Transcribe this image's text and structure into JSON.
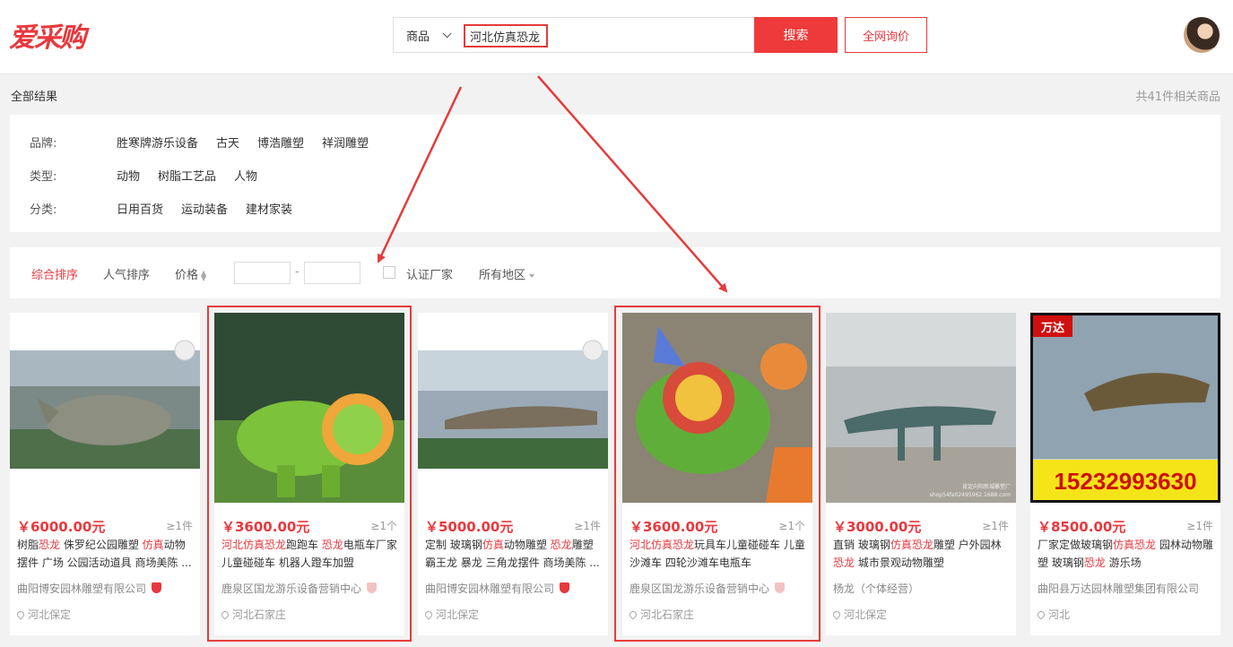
{
  "header": {
    "logo_text": "爱采购",
    "search_category": "商品",
    "search_query": "河北仿真恐龙",
    "search_button": "搜索",
    "inquiry_button": "全网询价"
  },
  "results": {
    "title": "全部结果",
    "count": "共41件相关商品"
  },
  "filters": {
    "brand": {
      "label": "品牌:",
      "options": [
        "胜寒牌游乐设备",
        "古天",
        "博浩雕塑",
        "祥润雕塑"
      ]
    },
    "type": {
      "label": "类型:",
      "options": [
        "动物",
        "树脂工艺品",
        "人物"
      ]
    },
    "category": {
      "label": "分类:",
      "options": [
        "日用百货",
        "运动装备",
        "建材家装"
      ]
    }
  },
  "sortbar": {
    "comprehensive": "综合排序",
    "popularity": "人气排序",
    "price": "价格",
    "price_dash": "-",
    "certified": "认证厂家",
    "region": "所有地区"
  },
  "products": [
    {
      "price": "￥6000.00元",
      "moq": "≥1件",
      "title_parts": [
        [
          "树脂",
          false
        ],
        [
          "恐龙",
          true
        ],
        [
          " 侏罗纪公园雕塑 ",
          false
        ],
        [
          "仿真",
          true
        ],
        [
          "动物摆件 广场 公园活动道具 商场美陈 ...",
          false
        ]
      ],
      "company": "曲阳博安园林雕塑有限公司",
      "badge": "red",
      "location": "河北保定"
    },
    {
      "price": "￥3600.00元",
      "moq": "≥1个",
      "title_parts": [
        [
          "河北仿真恐龙",
          true
        ],
        [
          "跑跑车 ",
          false
        ],
        [
          "恐龙",
          true
        ],
        [
          "电瓶车厂家 儿童碰碰车 机器人蹬车加盟",
          false
        ]
      ],
      "company": "鹿泉区国龙游乐设备营销中心",
      "badge": "pale",
      "location": "河北石家庄"
    },
    {
      "price": "￥5000.00元",
      "moq": "≥1件",
      "title_parts": [
        [
          "定制 玻璃钢",
          false
        ],
        [
          "仿真",
          true
        ],
        [
          "动物雕塑 ",
          false
        ],
        [
          "恐龙",
          true
        ],
        [
          "雕塑 霸王龙 暴龙 三角龙摆件 商场美陈 ...",
          false
        ]
      ],
      "company": "曲阳博安园林雕塑有限公司",
      "badge": "red",
      "location": "河北保定"
    },
    {
      "price": "￥3600.00元",
      "moq": "≥1个",
      "title_parts": [
        [
          "河北仿真恐龙",
          true
        ],
        [
          "玩具车儿童碰碰车 儿童沙滩车 四轮沙滩车电瓶车",
          false
        ]
      ],
      "company": "鹿泉区国龙游乐设备营销中心",
      "badge": "pale",
      "location": "河北石家庄"
    },
    {
      "price": "￥3000.00元",
      "moq": "≥1件",
      "title_parts": [
        [
          "直销 玻璃钢",
          false
        ],
        [
          "仿真恐龙",
          true
        ],
        [
          "雕塑 户外园林 ",
          false
        ],
        [
          "恐龙",
          true
        ],
        [
          " 城市景观动物雕塑",
          false
        ]
      ],
      "company": "杨龙（个体经营）",
      "badge": "",
      "location": "河北保定"
    },
    {
      "price": "￥8500.00元",
      "moq": "≥1件",
      "title_parts": [
        [
          "厂家定做玻璃钢",
          false
        ],
        [
          "仿真恐龙",
          true
        ],
        [
          " 园林动物雕塑 玻璃钢",
          false
        ],
        [
          "恐龙",
          true
        ],
        [
          " 游乐场",
          false
        ]
      ],
      "company": "曲阳县万达园林雕塑集团有限公司",
      "badge": "",
      "location": "河北"
    }
  ],
  "image_text": {
    "phone": "15232993630",
    "brand_tag": "万达",
    "watermark": "肯定向阳新城雕塑厂",
    "watermark_url": "shop54fe02495962.1688.com"
  },
  "colors": {
    "accent": "#e8383d",
    "annotation": "#e63b3b"
  }
}
